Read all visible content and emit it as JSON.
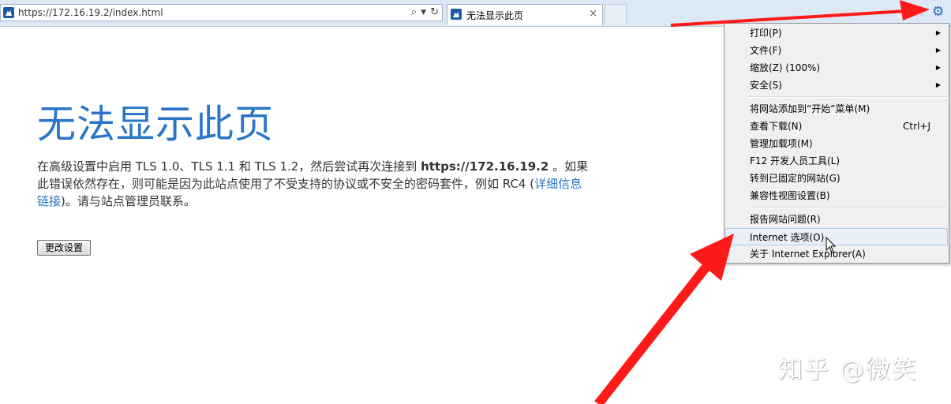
{
  "browser": {
    "address_url": "https://172.16.19.2/index.html",
    "address_icons": [
      "search-icon",
      "dropdown-icon",
      "refresh-icon"
    ],
    "tab_title": "无法显示此页",
    "tab_close": "×"
  },
  "page": {
    "heading": "无法显示此页",
    "desc_part1": "在高级设置中启用 TLS 1.0、TLS 1.1 和 TLS 1.2，然后尝试再次连接到 ",
    "desc_host": "https://172.16.19.2",
    "desc_part2": " 。如果此错误依然存在，则可能是因为此站点使用了不受支持的协议或不安全的密码套件，例如 RC4 (",
    "desc_link": "详细信息链接",
    "desc_part3": ")。请与站点管理员联系。",
    "button_label": "更改设置"
  },
  "menu": {
    "items": [
      {
        "label": "打印(P)",
        "shortcut": "",
        "submenu": true
      },
      {
        "label": "文件(F)",
        "shortcut": "",
        "submenu": true
      },
      {
        "label": "缩放(Z) (100%)",
        "shortcut": "",
        "submenu": true
      },
      {
        "label": "安全(S)",
        "shortcut": "",
        "submenu": true
      },
      {
        "label": "将网站添加到“开始”菜单(M)",
        "shortcut": "",
        "submenu": false
      },
      {
        "label": "查看下载(N)",
        "shortcut": "Ctrl+J",
        "submenu": false
      },
      {
        "label": "管理加载项(M)",
        "shortcut": "",
        "submenu": false
      },
      {
        "label": "F12 开发人员工具(L)",
        "shortcut": "",
        "submenu": false
      },
      {
        "label": "转到已固定的网站(G)",
        "shortcut": "",
        "submenu": false
      },
      {
        "label": "兼容性视图设置(B)",
        "shortcut": "",
        "submenu": false
      },
      {
        "label": "报告网站问题(R)",
        "shortcut": "",
        "submenu": false
      },
      {
        "label": "Internet 选项(O)",
        "shortcut": "",
        "submenu": false,
        "highlighted": true
      },
      {
        "label": "关于 Internet Explorer(A)",
        "shortcut": "",
        "submenu": false
      }
    ],
    "submenu_arrow": "▶"
  },
  "watermark": "知乎 @微笑",
  "colors": {
    "heading": "#2b75c9",
    "annotation_arrow": "#ff1a1a",
    "menu_highlight": "#e8eff8"
  }
}
